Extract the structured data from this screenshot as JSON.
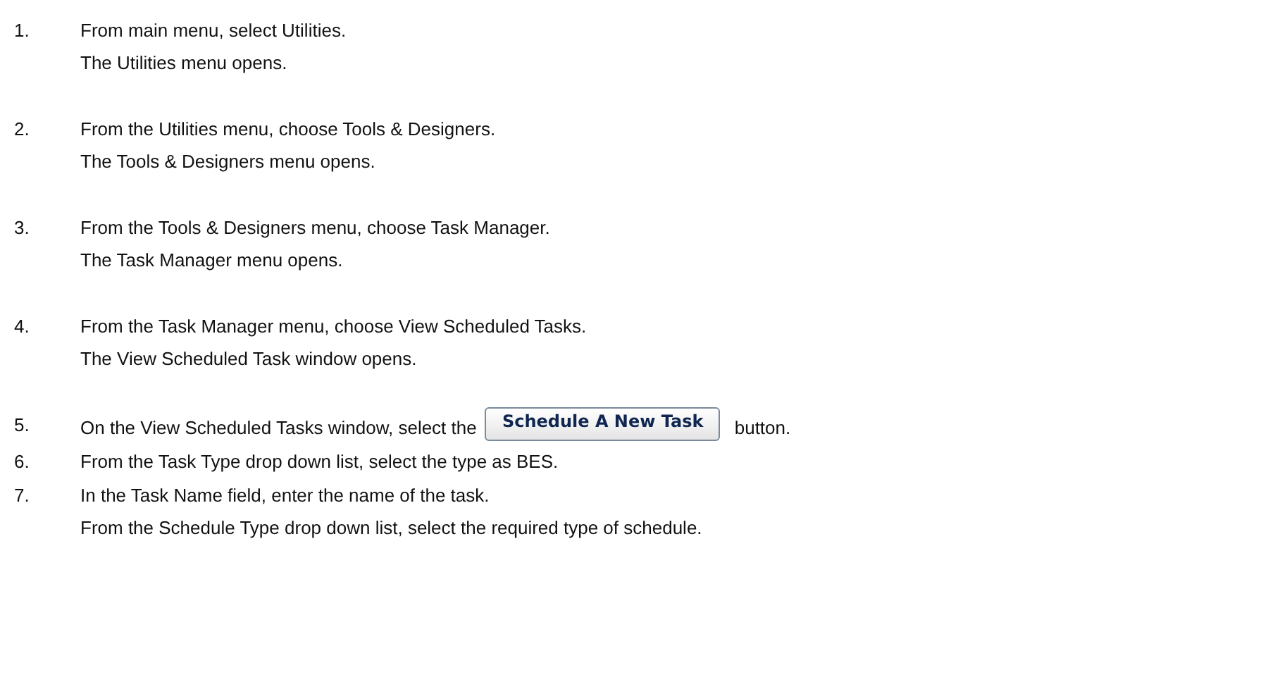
{
  "steps": [
    {
      "number": "1.",
      "text": "From main menu, select Utilities.",
      "result": "The Utilities menu opens."
    },
    {
      "number": "2.",
      "text": "From the Utilities menu, choose Tools & Designers.",
      "result": "The Tools & Designers menu opens."
    },
    {
      "number": "3.",
      "text": "From the Tools & Designers menu, choose Task Manager.",
      "result": "The Task Manager menu opens."
    },
    {
      "number": "4.",
      "text": "From the Task Manager menu, choose View Scheduled Tasks.",
      "result": "The View Scheduled Task window opens."
    },
    {
      "number": "5.",
      "text": "On the View Scheduled Tasks window, select the",
      "button": "Schedule A New Task",
      "text_after": "button."
    },
    {
      "number": "6.",
      "text": "From the Task Type drop down list, select the type as BES."
    },
    {
      "number": "7.",
      "text": "In the Task Name field, enter the name of the task.",
      "result": "From the Schedule Type drop down list, select the required type of schedule."
    }
  ]
}
